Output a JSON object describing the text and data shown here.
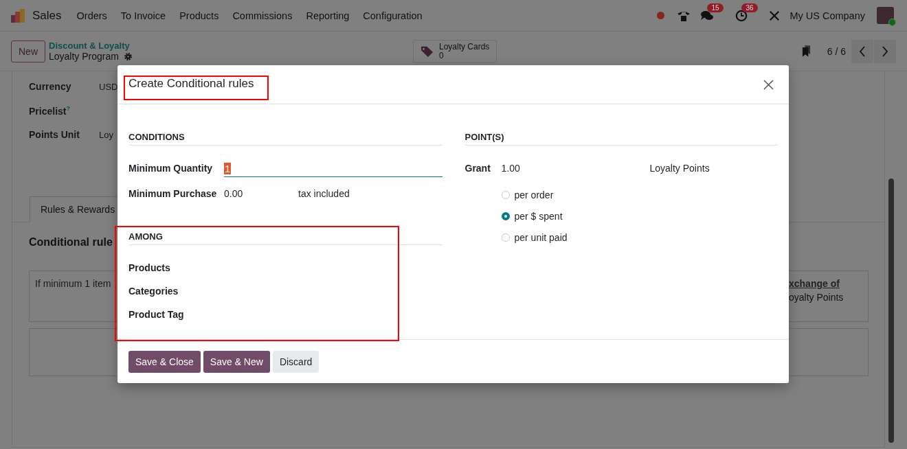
{
  "navbar": {
    "app": "Sales",
    "menu": [
      "Orders",
      "To Invoice",
      "Products",
      "Commissions",
      "Reporting",
      "Configuration"
    ],
    "messages_badge": "15",
    "activities_badge": "36",
    "company": "My US Company"
  },
  "control_panel": {
    "new_button": "New",
    "breadcrumb": "Discount & Loyalty",
    "record_title": "Loyalty Program",
    "smart_button": {
      "label": "Loyalty Cards",
      "count": "0"
    },
    "pager": "6 / 6"
  },
  "form": {
    "fields": [
      {
        "label": "Currency",
        "value": "USD"
      },
      {
        "label": "Pricelist",
        "help_mark": "?"
      },
      {
        "label": "Points Unit",
        "value": "Loy"
      }
    ],
    "tabs": [
      {
        "label": "Rules & Rewards",
        "selected": true
      }
    ],
    "section_title": "Conditional rule",
    "rule_card": {
      "text": "If minimum 1 item",
      "reward_link": "xchange of",
      "reward_text": "oyalty Points"
    }
  },
  "dialog": {
    "title": "Create Conditional rules",
    "conditions": {
      "heading": "CONDITIONS",
      "min_quantity": {
        "label": "Minimum Quantity",
        "value": "1"
      },
      "min_purchase": {
        "label": "Minimum Purchase",
        "value": "0.00",
        "tax": "tax included"
      }
    },
    "among": {
      "heading": "AMONG",
      "fields": [
        "Products",
        "Categories",
        "Product Tag"
      ]
    },
    "points": {
      "heading": "POINT(S)",
      "label": "Grant",
      "value": "1.00",
      "unit": "Loyalty Points",
      "modes": [
        {
          "label": "per order",
          "selected": false
        },
        {
          "label": "per $ spent",
          "selected": true
        },
        {
          "label": "per unit paid",
          "selected": false
        }
      ]
    },
    "buttons": [
      {
        "label": "Save & Close",
        "kind": "primary"
      },
      {
        "label": "Save & New",
        "kind": "primary"
      },
      {
        "label": "Discard",
        "kind": "secondary"
      }
    ]
  }
}
